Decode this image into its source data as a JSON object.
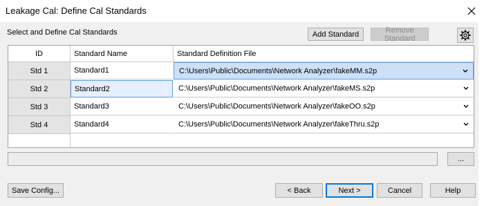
{
  "window": {
    "title": "Leakage Cal: Define Cal Standards"
  },
  "section": {
    "label": "Select and Define Cal Standards"
  },
  "toolbar": {
    "add_label": "Add Standard",
    "remove_label": "Remove Standard"
  },
  "grid": {
    "columns": [
      "ID",
      "Standard Name",
      "Standard Definition File"
    ],
    "rows": [
      {
        "id": "Std 1",
        "name": "Standard1",
        "file": "C:\\Users\\Public\\Documents\\Network Analyzer\\fakeMM.s2p"
      },
      {
        "id": "Std 2",
        "name": "Standard2",
        "file": "C:\\Users\\Public\\Documents\\Network Analyzer\\fakeMS.s2p"
      },
      {
        "id": "Std 3",
        "name": "Standard3",
        "file": "C:\\Users\\Public\\Documents\\Network Analyzer\\fakeOO.s2p"
      },
      {
        "id": "Std 4",
        "name": "Standard4",
        "file": "C:\\Users\\Public\\Documents\\Network Analyzer\\fakeThru.s2p"
      }
    ]
  },
  "path": {
    "value": "",
    "browse_label": "..."
  },
  "footer": {
    "save_config_label": "Save Config...",
    "back_label": "< Back",
    "next_label": "Next >",
    "cancel_label": "Cancel",
    "help_label": "Help"
  },
  "icons": {
    "close": "close-icon",
    "gear": "gear-icon",
    "dropdown": "chevron-down-icon"
  },
  "colors": {
    "accent": "#0078d7",
    "selected_row": "#cce0f7",
    "focused_cell": "#e5efff"
  }
}
